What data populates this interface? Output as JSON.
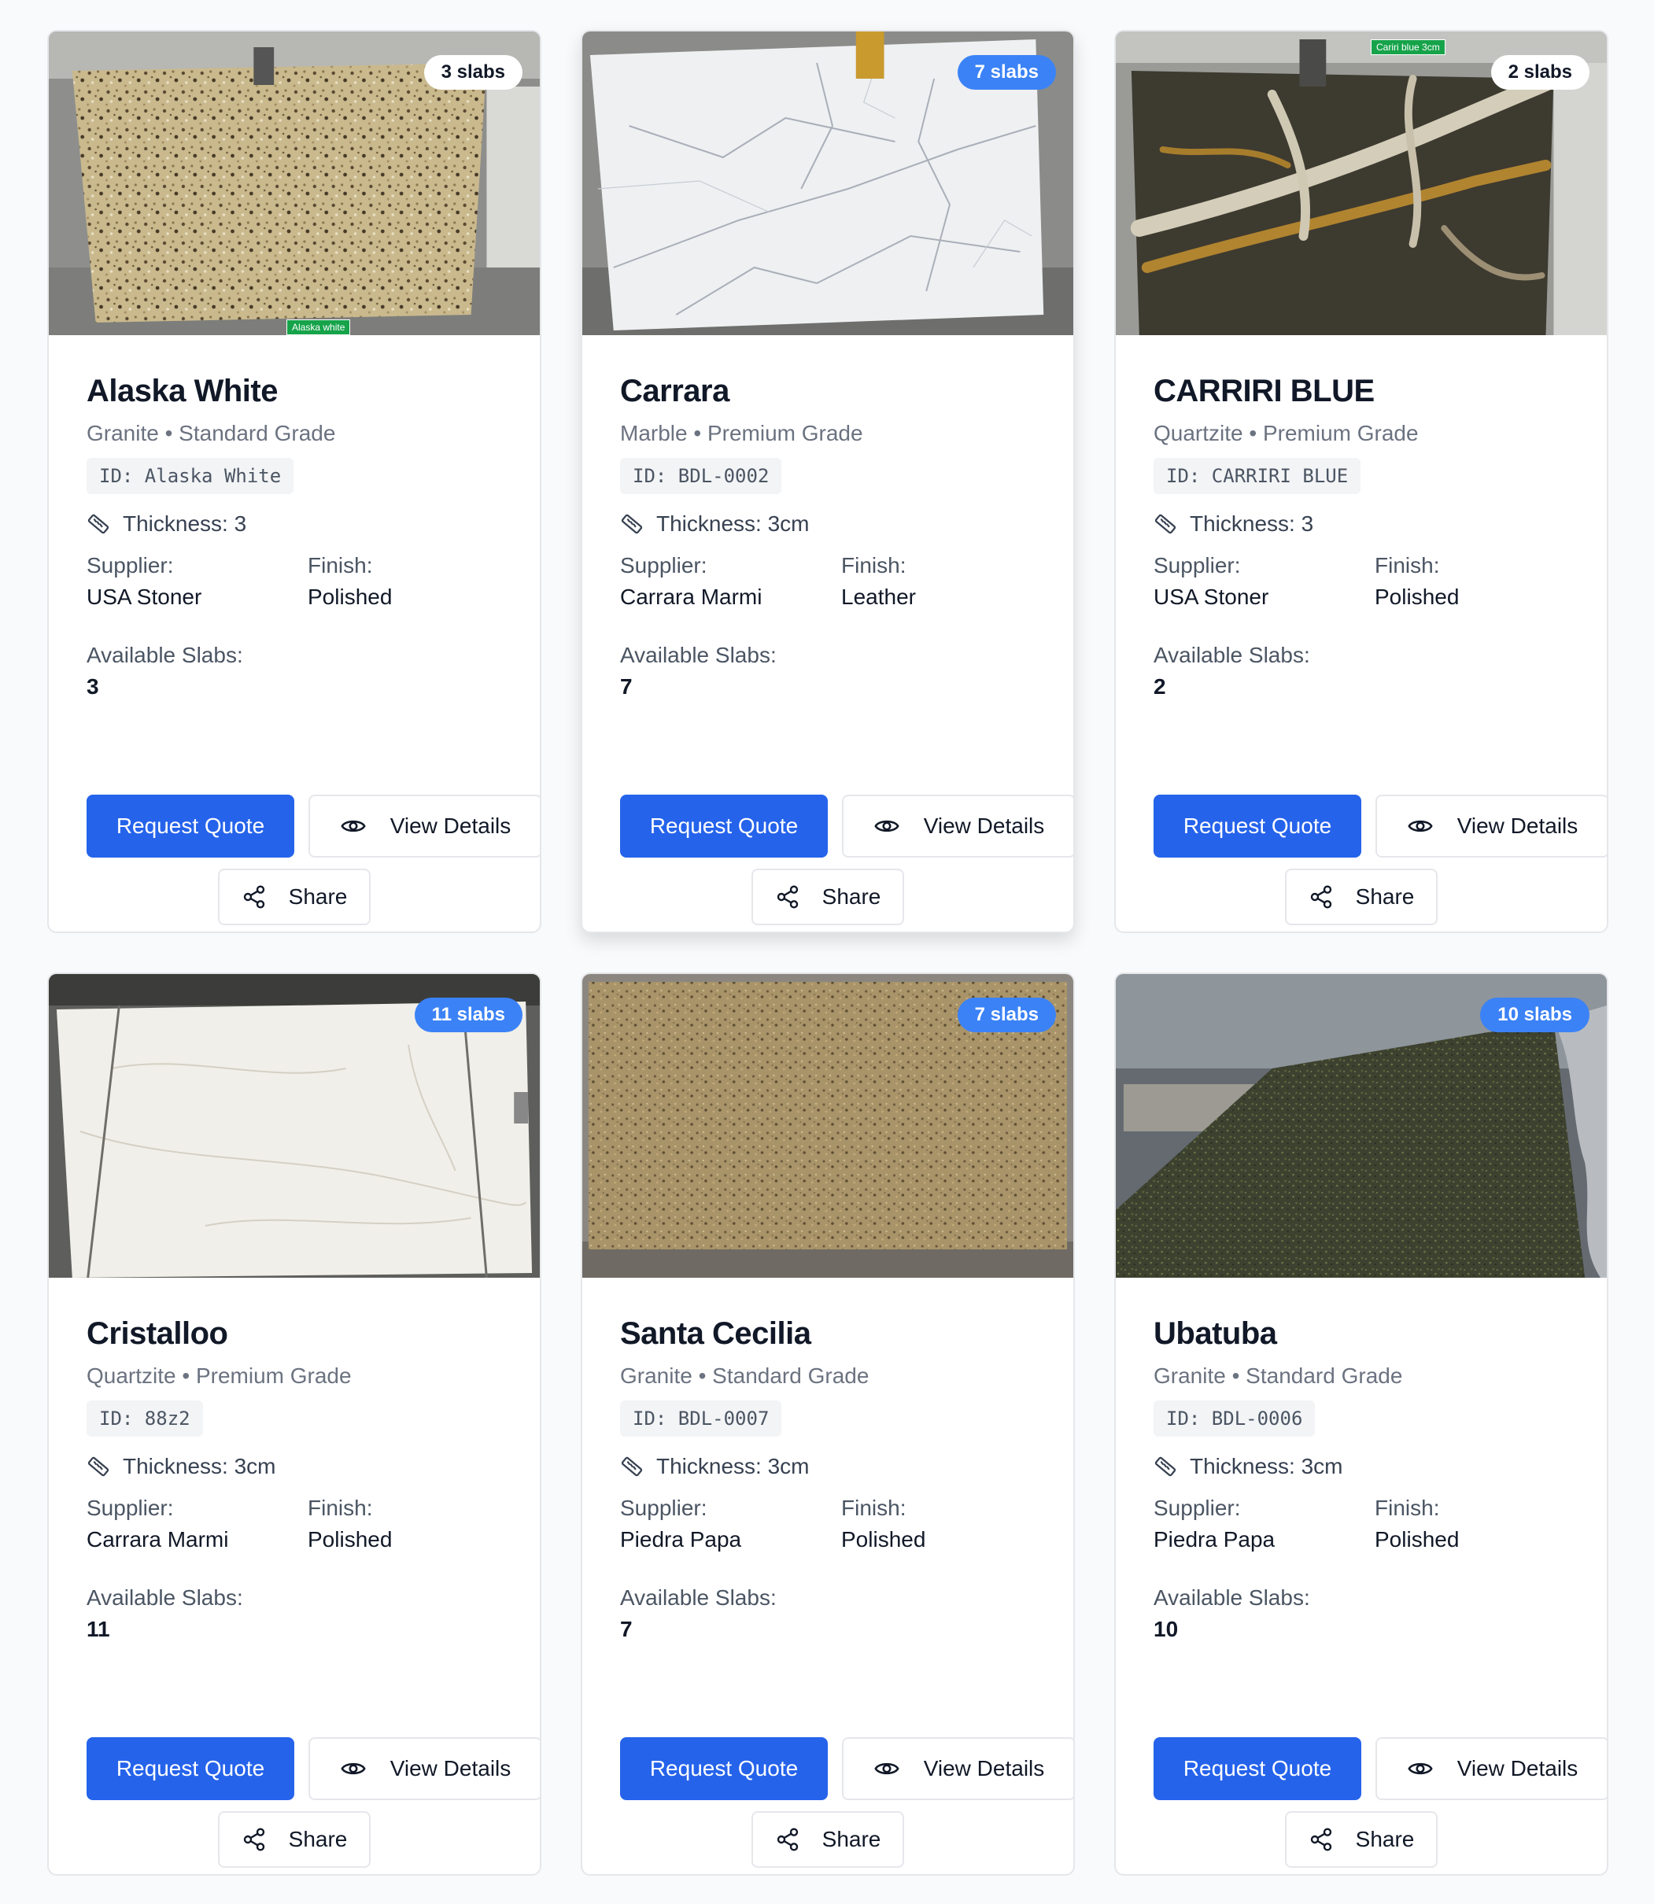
{
  "labels": {
    "supplier": "Supplier:",
    "finish": "Finish:",
    "available": "Available Slabs:",
    "request_quote": "Request Quote",
    "view_details": "View Details",
    "share": "Share"
  },
  "colors": {
    "primary": "#2563eb",
    "badge_blue": "#3b82f6",
    "border": "#e5e7eb",
    "muted_text": "#6b7280"
  },
  "icons": {
    "thickness": "ruler-icon",
    "view": "eye-icon",
    "share": "share-icon"
  },
  "products": [
    {
      "name": "Alaska White",
      "subtitle": "Granite • Standard Grade",
      "id_text": "ID: Alaska White",
      "thickness": "Thickness: 3",
      "supplier": "USA Stoner",
      "finish": "Polished",
      "available": "3",
      "badge": "3 slabs",
      "badge_style": "light",
      "photo_tag": "Alaska white"
    },
    {
      "name": "Carrara",
      "subtitle": "Marble • Premium Grade",
      "id_text": "ID: BDL-0002",
      "thickness": "Thickness: 3cm",
      "supplier": "Carrara Marmi",
      "finish": "Leather",
      "available": "7",
      "badge": "7 slabs",
      "badge_style": "blue"
    },
    {
      "name": "CARRIRI BLUE",
      "subtitle": "Quartzite • Premium Grade",
      "id_text": "ID: CARRIRI BLUE",
      "thickness": "Thickness: 3",
      "supplier": "USA Stoner",
      "finish": "Polished",
      "available": "2",
      "badge": "2 slabs",
      "badge_style": "light",
      "photo_tag": "Cariri blue 3cm"
    },
    {
      "name": "Cristalloo",
      "subtitle": "Quartzite • Premium Grade",
      "id_text": "ID: 88z2",
      "thickness": "Thickness: 3cm",
      "supplier": "Carrara Marmi",
      "finish": "Polished",
      "available": "11",
      "badge": "11 slabs",
      "badge_style": "blue"
    },
    {
      "name": "Santa Cecilia",
      "subtitle": "Granite • Standard Grade",
      "id_text": "ID: BDL-0007",
      "thickness": "Thickness: 3cm",
      "supplier": "Piedra Papa",
      "finish": "Polished",
      "available": "7",
      "badge": "7 slabs",
      "badge_style": "blue"
    },
    {
      "name": "Ubatuba",
      "subtitle": "Granite • Standard Grade",
      "id_text": "ID: BDL-0006",
      "thickness": "Thickness: 3cm",
      "supplier": "Piedra Papa",
      "finish": "Polished",
      "available": "10",
      "badge": "10 slabs",
      "badge_style": "blue"
    }
  ]
}
